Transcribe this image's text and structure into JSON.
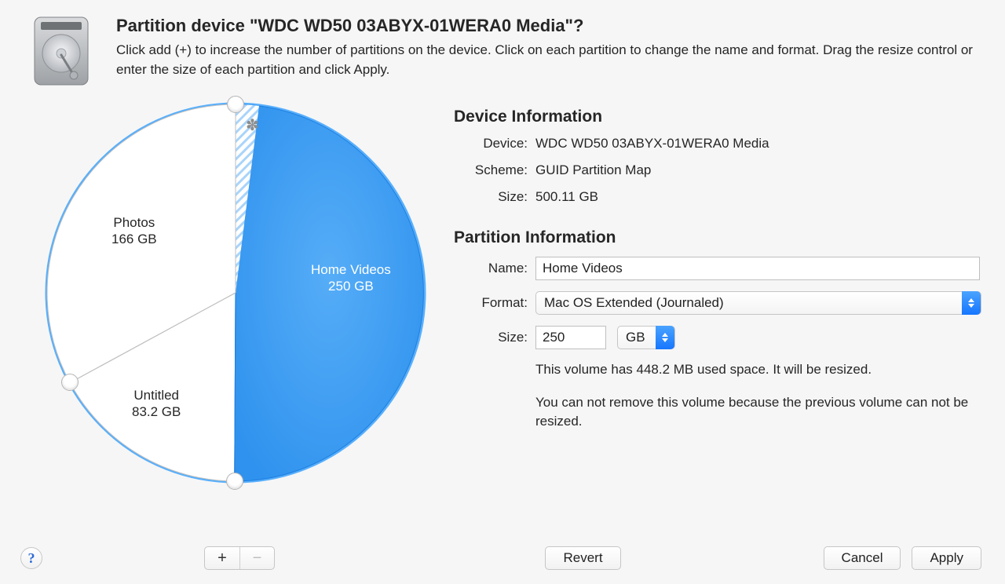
{
  "header": {
    "title": "Partition device \"WDC WD50 03ABYX-01WERA0 Media\"?",
    "subtitle": "Click add (+) to increase the number of partitions on the device. Click on each partition to change the name and format. Drag the resize control or enter the size of each partition and click Apply."
  },
  "chart_data": {
    "type": "pie",
    "title": "",
    "slices": [
      {
        "name": "Home Videos",
        "size_label": "250 GB",
        "value_gb": 250.0,
        "selected": true
      },
      {
        "name": "Untitled",
        "size_label": "83.2 GB",
        "value_gb": 83.2,
        "selected": false
      },
      {
        "name": "Photos",
        "size_label": "166 GB",
        "value_gb": 166.0,
        "selected": false
      }
    ],
    "total_gb": 500.11
  },
  "device_info": {
    "section_title": "Device Information",
    "labels": {
      "device": "Device:",
      "scheme": "Scheme:",
      "size": "Size:"
    },
    "device": "WDC WD50 03ABYX-01WERA0 Media",
    "scheme": "GUID Partition Map",
    "size": "500.11 GB"
  },
  "partition_info": {
    "section_title": "Partition Information",
    "labels": {
      "name": "Name:",
      "format": "Format:",
      "size": "Size:"
    },
    "name_value": "Home Videos",
    "format_value": "Mac OS Extended (Journaled)",
    "size_value": "250",
    "size_unit": "GB",
    "note1": "This volume has 448.2 MB used space. It will be resized.",
    "note2": "You can not remove this volume because the previous volume can not be resized."
  },
  "footer": {
    "help_char": "?",
    "add_label": "+",
    "remove_label": "−",
    "revert": "Revert",
    "cancel": "Cancel",
    "apply": "Apply"
  },
  "colors": {
    "selected_fill": "#3d9cf2",
    "ring": "#57affc",
    "hatch": "#a9d4fa"
  }
}
